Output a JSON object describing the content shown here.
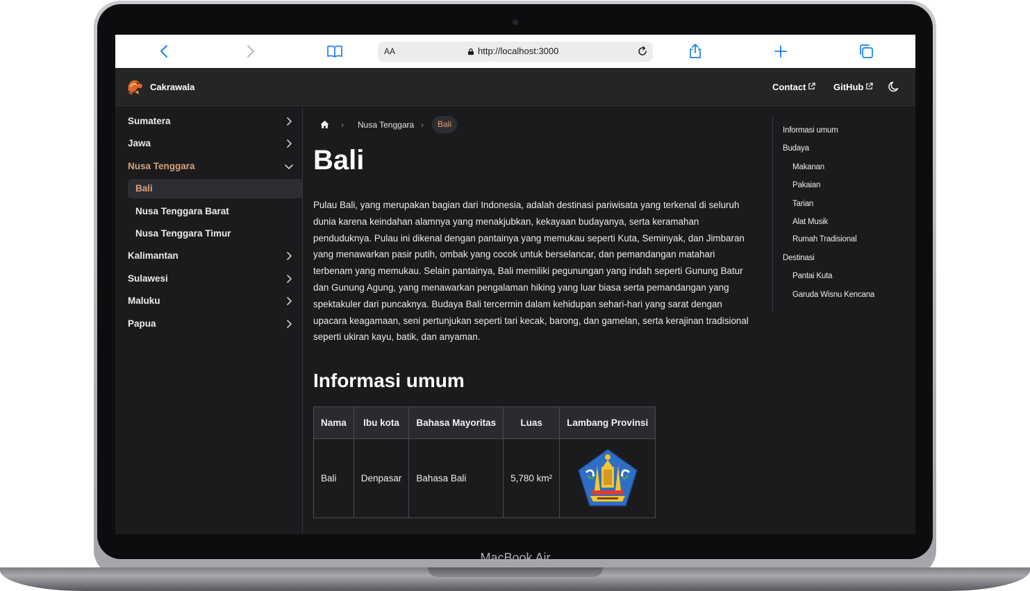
{
  "device": {
    "label": "MacBook Air"
  },
  "browser": {
    "text_size_label": "AA",
    "url": "http://localhost:3000",
    "icons": [
      "back-icon",
      "forward-icon",
      "bookmarks-icon",
      "lock-icon",
      "reload-icon",
      "share-icon",
      "new-tab-icon",
      "tabs-icon"
    ]
  },
  "header": {
    "brand": "Cakrawala",
    "contact_label": "Contact",
    "github_label": "GitHub",
    "theme_icon": "moon-icon"
  },
  "sidebar": {
    "items": [
      {
        "label": "Sumatera"
      },
      {
        "label": "Jawa"
      },
      {
        "label": "Nusa Tenggara",
        "expanded": true,
        "children": [
          {
            "label": "Bali",
            "current": true
          },
          {
            "label": "Nusa Tenggara Barat"
          },
          {
            "label": "Nusa Tenggara Timur"
          }
        ]
      },
      {
        "label": "Kalimantan"
      },
      {
        "label": "Sulawesi"
      },
      {
        "label": "Maluku"
      },
      {
        "label": "Papua"
      }
    ]
  },
  "breadcrumb": {
    "parent": "Nusa Tenggara",
    "current": "Bali"
  },
  "article": {
    "title": "Bali",
    "intro": "Pulau Bali, yang merupakan bagian dari Indonesia, adalah destinasi pariwisata yang terkenal di seluruh dunia karena keindahan alamnya yang menakjubkan, kekayaan budayanya, serta keramahan penduduknya. Pulau ini dikenal dengan pantainya yang memukau seperti Kuta, Seminyak, dan Jimbaran yang menawarkan pasir putih, ombak yang cocok untuk berselancar, dan pemandangan matahari terbenam yang memukau. Selain pantainya, Bali memiliki pegunungan yang indah seperti Gunung Batur dan Gunung Agung, yang menawarkan pengalaman hiking yang luar biasa serta pemandangan yang spektakuler dari puncaknya. Budaya Bali tercermin dalam kehidupan sehari-hari yang sarat dengan upacara keagamaan, seni pertunjukan seperti tari kecak, barong, dan gamelan, serta kerajinan tradisional seperti ukiran kayu, batik, dan anyaman.",
    "section_title": "Informasi umum",
    "table": {
      "headers": [
        "Nama",
        "Ibu kota",
        "Bahasa Mayoritas",
        "Luas",
        "Lambang Provinsi"
      ],
      "row": [
        "Bali",
        "Denpasar",
        "Bahasa Bali",
        "5,780 km²"
      ]
    }
  },
  "toc": [
    {
      "label": "Informasi umum",
      "level": 1
    },
    {
      "label": "Budaya",
      "level": 1
    },
    {
      "label": "Makanan",
      "level": 2
    },
    {
      "label": "Pakaian",
      "level": 2
    },
    {
      "label": "Tarian",
      "level": 2
    },
    {
      "label": "Alat Musik",
      "level": 2
    },
    {
      "label": "Rumah Tradisional",
      "level": 2
    },
    {
      "label": "Destinasi",
      "level": 1
    },
    {
      "label": "Pantai Kuta",
      "level": 2
    },
    {
      "label": "Garuda Wisnu Kencana",
      "level": 2
    }
  ],
  "colors": {
    "accent": "#d7a27d",
    "background": "#1b1b1d",
    "navbar": "#242526",
    "safari_blue": "#1a7cf5"
  }
}
